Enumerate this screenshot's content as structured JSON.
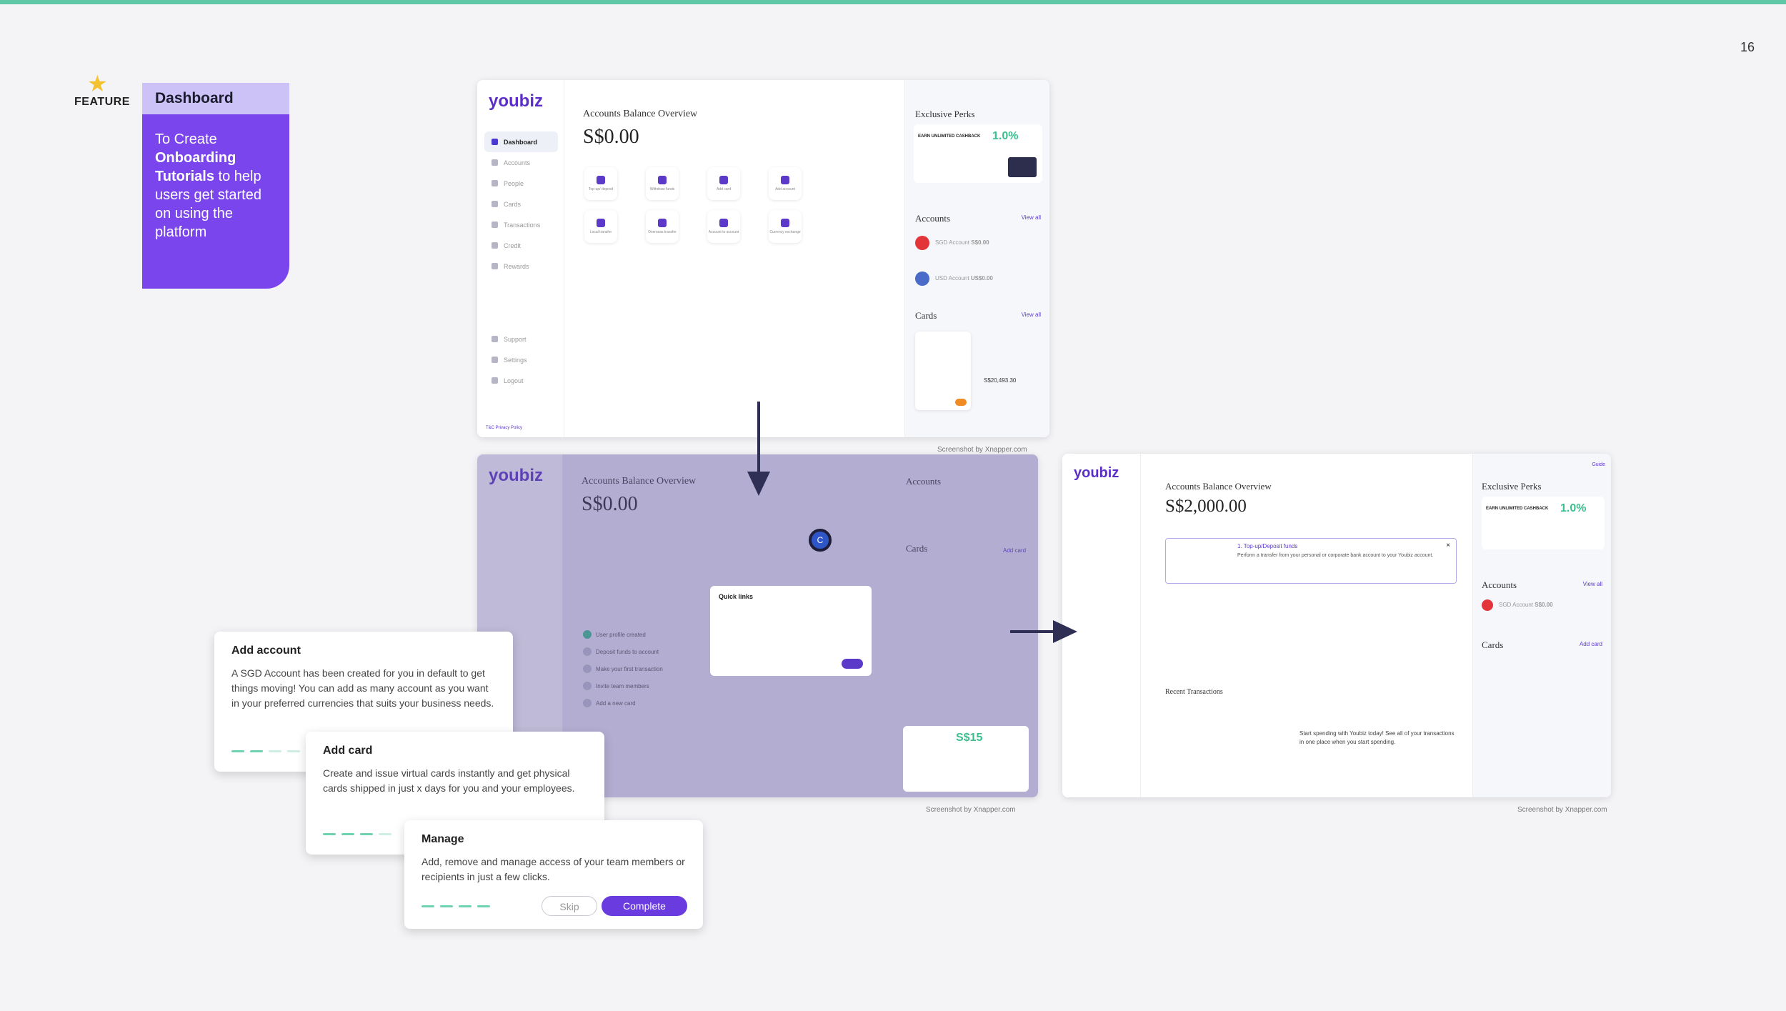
{
  "page_number": "16",
  "feature_label": "FEATURE",
  "feature_card": {
    "title": "Dashboard",
    "body_pre": "To Create ",
    "body_bold": "Onboarding Tutorials",
    "body_post": " to help users get started on using the platform"
  },
  "shot_top": {
    "logo": "youbiz",
    "nav": [
      "Dashboard",
      "Accounts",
      "People",
      "Cards",
      "Transactions",
      "Credit",
      "Rewards"
    ],
    "nav_bottom": [
      "Support",
      "Settings",
      "Logout"
    ],
    "footer_link": "T&C Privacy Policy",
    "heading": "Accounts Balance Overview",
    "balance": "S$0.00",
    "quick_actions": [
      "Top-up/ deposit",
      "Withdraw funds",
      "Add card",
      "Add account",
      "Local transfer",
      "Overseas transfer",
      "Account to account",
      "Currency exchange"
    ],
    "perks_title": "Exclusive Perks",
    "perk_text": "EARN UNLIMITED CASHBACK",
    "perk_pct": "1.0%",
    "accounts_title": "Accounts",
    "view_all": "View all",
    "accounts": [
      {
        "name": "SGD Account",
        "amount": "S$0.00"
      },
      {
        "name": "USD Account",
        "amount": "US$0.00"
      }
    ],
    "cards_title": "Cards",
    "card_spend": "S$20,493.30",
    "caption": "Screenshot by Xnapper.com"
  },
  "shot_mid": {
    "logo": "youbiz",
    "heading": "Accounts Balance Overview",
    "balance": "S$0.00",
    "accounts_title": "Accounts",
    "cards_title": "Cards",
    "add_card": "Add card",
    "avatar_letter": "C",
    "quick_links_title": "Quick links",
    "checklist": [
      "User profile created",
      "Deposit funds to account",
      "Make your first transaction",
      "Invite team members",
      "Add a new card"
    ],
    "promo_amount": "S$15",
    "caption": "Screenshot by Xnapper.com"
  },
  "shot_right": {
    "logo": "youbiz",
    "guide": "Guide",
    "heading": "Accounts Balance Overview",
    "balance": "S$2,000.00",
    "tip_title": "1. Top-up/Deposit funds",
    "tip_text": "Perform a transfer from your personal or corporate bank account to your Youbiz account.",
    "perks_title": "Exclusive Perks",
    "perk_text": "EARN UNLIMITED CASHBACK",
    "perk_pct": "1.0%",
    "accounts_title": "Accounts",
    "view_all": "View all",
    "account_name": "SGD Account",
    "account_amount": "S$0.00",
    "cards_title": "Cards",
    "add_card": "Add card",
    "recent_title": "Recent Transactions",
    "recent_text": "Start spending with Youbiz today! See all of your transactions in one place when you start spending.",
    "caption": "Screenshot by Xnapper.com"
  },
  "popups": {
    "add_account": {
      "title": "Add account",
      "text": "A SGD Account has been created for you in default to get things moving! You can add as many account as you want in your preferred currencies that suits your business needs."
    },
    "add_card": {
      "title": "Add card",
      "text": "Create and issue virtual cards instantly and get physical cards shipped in just x days for you and your employees."
    },
    "manage": {
      "title": "Manage",
      "text": "Add, remove and manage access of your team members or recipients in just a few clicks.",
      "skip": "Skip",
      "complete": "Complete"
    }
  },
  "colors": {
    "accent": "#7a45ec",
    "teal": "#5ec8a6",
    "brand": "#5b2ec9"
  }
}
